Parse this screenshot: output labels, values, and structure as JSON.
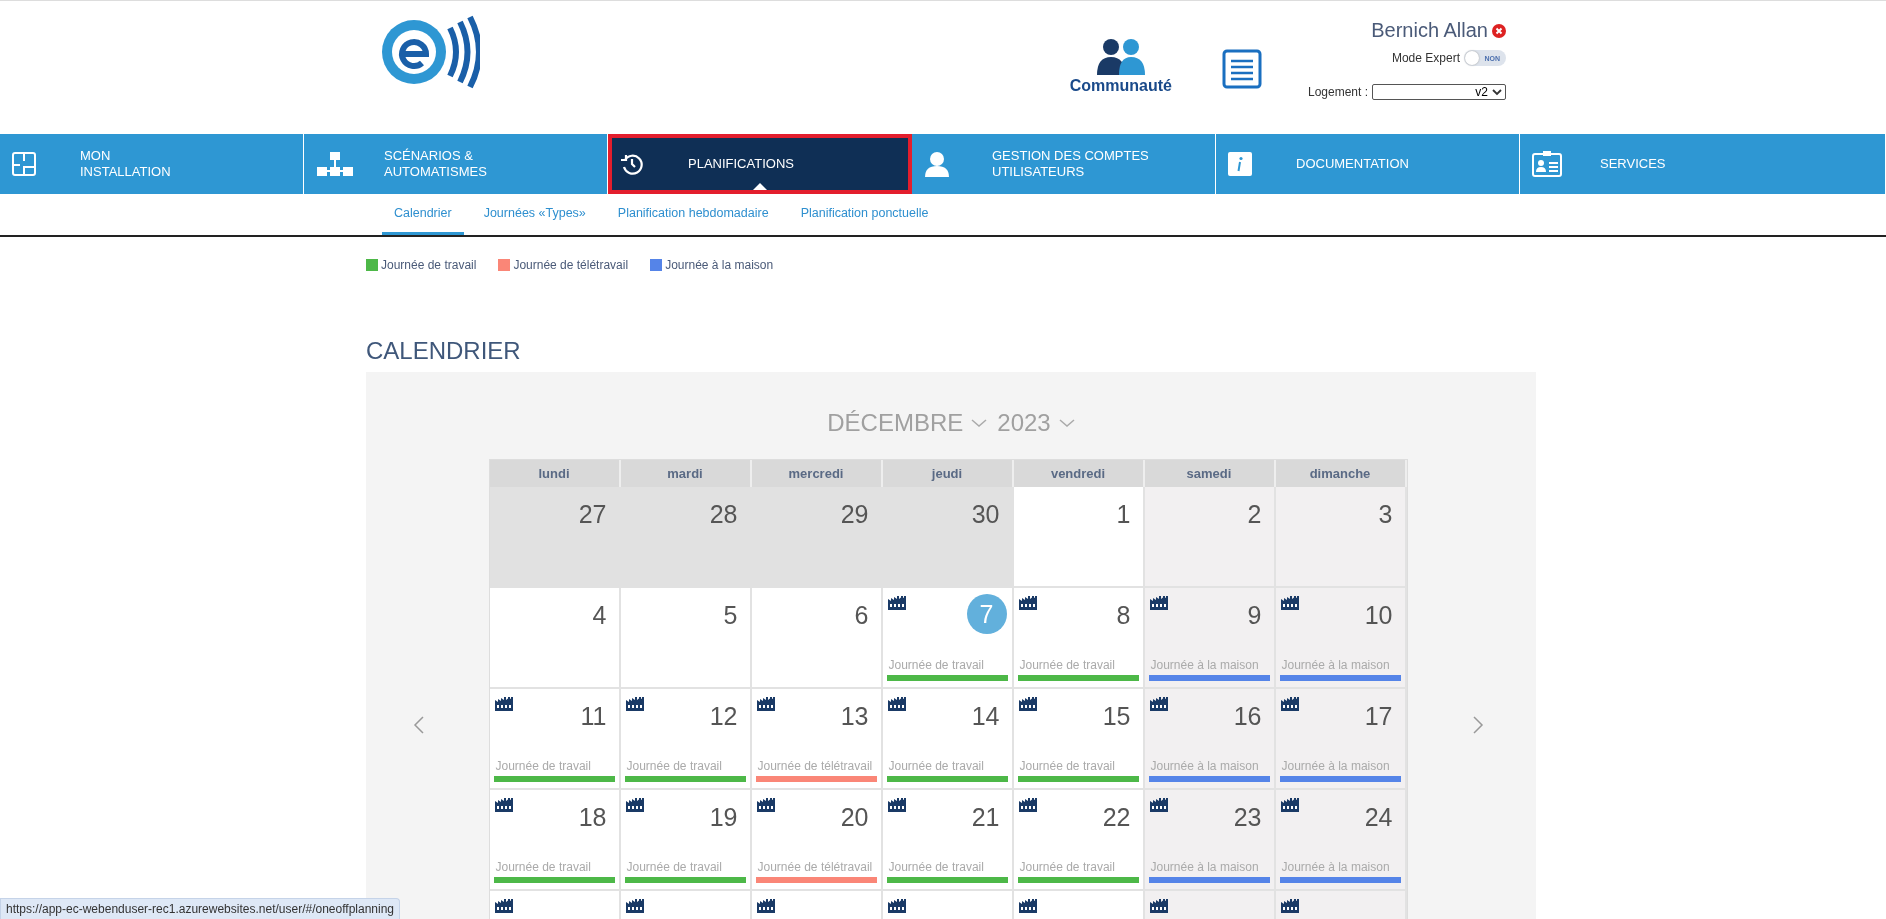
{
  "header": {
    "user_name": "Bernich Allan",
    "community_label": "Communauté",
    "mode_expert": {
      "label": "Mode Expert",
      "on": false,
      "toggle_text": "NON"
    },
    "logement": {
      "label": "Logement :",
      "value": "v2"
    }
  },
  "nav": [
    {
      "kind": "installation",
      "lines": [
        "MON",
        "INSTALLATION"
      ],
      "selected": false
    },
    {
      "kind": "scenarios",
      "lines": [
        "SCÉNARIOS &",
        "AUTOMATISMES"
      ],
      "selected": false
    },
    {
      "kind": "planning",
      "lines": [
        "PLANIFICATIONS"
      ],
      "selected": true
    },
    {
      "kind": "users",
      "lines": [
        "GESTION DES COMPTES",
        "UTILISATEURS"
      ],
      "selected": false
    },
    {
      "kind": "info",
      "lines": [
        "DOCUMENTATION"
      ],
      "selected": false
    },
    {
      "kind": "services",
      "lines": [
        "SERVICES"
      ],
      "selected": false
    }
  ],
  "subtabs": [
    {
      "label": "Calendrier",
      "selected": true
    },
    {
      "label": "Journées «Types»",
      "selected": false
    },
    {
      "label": "Planification hebdomadaire",
      "selected": false
    },
    {
      "label": "Planification ponctuelle",
      "selected": false
    }
  ],
  "legend": [
    {
      "label": "Journée de travail",
      "color": "#4db848"
    },
    {
      "label": "Journée de télétravail",
      "color": "#fa8677"
    },
    {
      "label": "Journée à la maison",
      "color": "#5584e8"
    }
  ],
  "calendar": {
    "title": "CALENDRIER",
    "month": "DÉCEMBRE",
    "year": "2023",
    "weekdays": [
      "lundi",
      "mardi",
      "mercredi",
      "jeudi",
      "vendredi",
      "samedi",
      "dimanche"
    ],
    "weeks": [
      {
        "days": [
          {
            "day": "27",
            "kind": "other_month",
            "today": false
          },
          {
            "day": "28",
            "kind": "other_month",
            "today": false
          },
          {
            "day": "29",
            "kind": "other_month",
            "today": false
          },
          {
            "day": "30",
            "kind": "other_month",
            "today": false
          },
          {
            "day": "1",
            "kind": "weekday",
            "today": false
          },
          {
            "day": "2",
            "kind": "weekend",
            "today": false
          },
          {
            "day": "3",
            "kind": "weekend",
            "today": false
          }
        ]
      },
      {
        "days": [
          {
            "day": "4",
            "kind": "weekday",
            "today": false
          },
          {
            "day": "5",
            "kind": "weekday",
            "today": false
          },
          {
            "day": "6",
            "kind": "weekday",
            "today": false
          },
          {
            "day": "7",
            "kind": "weekday",
            "today": true,
            "entry": {
              "label": "Journée de travail",
              "color": "#4db848"
            }
          },
          {
            "day": "8",
            "kind": "weekday",
            "today": false,
            "entry": {
              "label": "Journée de travail",
              "color": "#4db848"
            }
          },
          {
            "day": "9",
            "kind": "weekend",
            "today": false,
            "entry": {
              "label": "Journée à la maison",
              "color": "#5584e8"
            }
          },
          {
            "day": "10",
            "kind": "weekend",
            "today": false,
            "entry": {
              "label": "Journée à la maison",
              "color": "#5584e8"
            }
          }
        ]
      },
      {
        "days": [
          {
            "day": "11",
            "kind": "weekday",
            "today": false,
            "entry": {
              "label": "Journée de travail",
              "color": "#4db848"
            }
          },
          {
            "day": "12",
            "kind": "weekday",
            "today": false,
            "entry": {
              "label": "Journée de travail",
              "color": "#4db848"
            }
          },
          {
            "day": "13",
            "kind": "weekday",
            "today": false,
            "entry": {
              "label": "Journée de télétravail",
              "color": "#fa8677"
            }
          },
          {
            "day": "14",
            "kind": "weekday",
            "today": false,
            "entry": {
              "label": "Journée de travail",
              "color": "#4db848"
            }
          },
          {
            "day": "15",
            "kind": "weekday",
            "today": false,
            "entry": {
              "label": "Journée de travail",
              "color": "#4db848"
            }
          },
          {
            "day": "16",
            "kind": "weekend",
            "today": false,
            "entry": {
              "label": "Journée à la maison",
              "color": "#5584e8"
            }
          },
          {
            "day": "17",
            "kind": "weekend",
            "today": false,
            "entry": {
              "label": "Journée à la maison",
              "color": "#5584e8"
            }
          }
        ]
      },
      {
        "days": [
          {
            "day": "18",
            "kind": "weekday",
            "today": false,
            "entry": {
              "label": "Journée de travail",
              "color": "#4db848"
            }
          },
          {
            "day": "19",
            "kind": "weekday",
            "today": false,
            "entry": {
              "label": "Journée de travail",
              "color": "#4db848"
            }
          },
          {
            "day": "20",
            "kind": "weekday",
            "today": false,
            "entry": {
              "label": "Journée de télétravail",
              "color": "#fa8677"
            }
          },
          {
            "day": "21",
            "kind": "weekday",
            "today": false,
            "entry": {
              "label": "Journée de travail",
              "color": "#4db848"
            }
          },
          {
            "day": "22",
            "kind": "weekday",
            "today": false,
            "entry": {
              "label": "Journée de travail",
              "color": "#4db848"
            }
          },
          {
            "day": "23",
            "kind": "weekend",
            "today": false,
            "entry": {
              "label": "Journée à la maison",
              "color": "#5584e8"
            }
          },
          {
            "day": "24",
            "kind": "weekend",
            "today": false,
            "entry": {
              "label": "Journée à la maison",
              "color": "#5584e8"
            }
          }
        ]
      },
      {
        "days": [
          {
            "kind": "weekday"
          },
          {
            "kind": "weekday"
          },
          {
            "kind": "weekday"
          },
          {
            "kind": "weekday"
          },
          {
            "kind": "weekday"
          },
          {
            "kind": "weekend"
          },
          {
            "kind": "weekend"
          }
        ]
      }
    ]
  },
  "status_url": "https://app-ec-webenduser-rec1.azurewebsites.net/user/#/oneoffplanning"
}
